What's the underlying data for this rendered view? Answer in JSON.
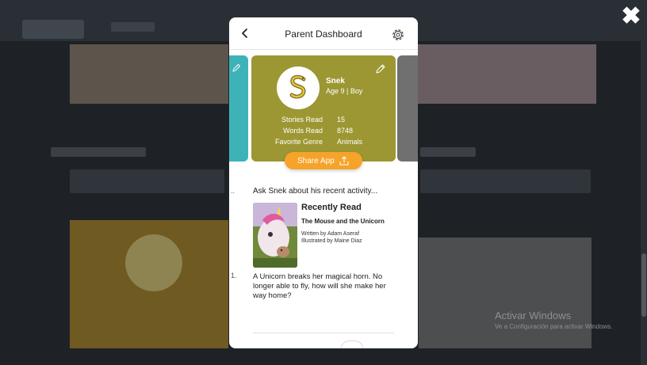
{
  "overlay": {
    "close_glyph": "✖"
  },
  "watermark": {
    "title": "Activar Windows",
    "subtitle": "Ve a Configuración para activar Windows."
  },
  "header": {
    "title": "Parent Dashboard"
  },
  "profile": {
    "name": "Snek",
    "meta": "Age 9 | Boy",
    "stats": [
      {
        "label": "Stories Read",
        "value": "15"
      },
      {
        "label": "Words Read",
        "value": "8748"
      },
      {
        "label": "Favorite Genre",
        "value": "Animals"
      }
    ],
    "card_color": "#9c9733",
    "prev_card_color": "#3db3b8",
    "next_card_color": "#707070"
  },
  "share": {
    "label": "Share App",
    "color": "#f6a32a"
  },
  "activity": {
    "ask_prompt": "Ask Snek about his recent activity...",
    "recently_read_heading": "Recently Read",
    "book_title": "The Mouse and the Unicorn",
    "written_by": "Written by Adam Aseraf",
    "illustrated_by": "Illustrated by Maine Diaz",
    "description": "A Unicorn breaks her magical horn. No longer able to fly, how will she make her way home?"
  },
  "side_marks": {
    "first": "..",
    "second": "1."
  },
  "icons": {
    "close": "close-x-icon",
    "back": "chevron-left-icon",
    "settings": "gear-icon",
    "edit": "pencil-icon",
    "share": "share-upload-icon",
    "avatar": "snake-icon"
  }
}
